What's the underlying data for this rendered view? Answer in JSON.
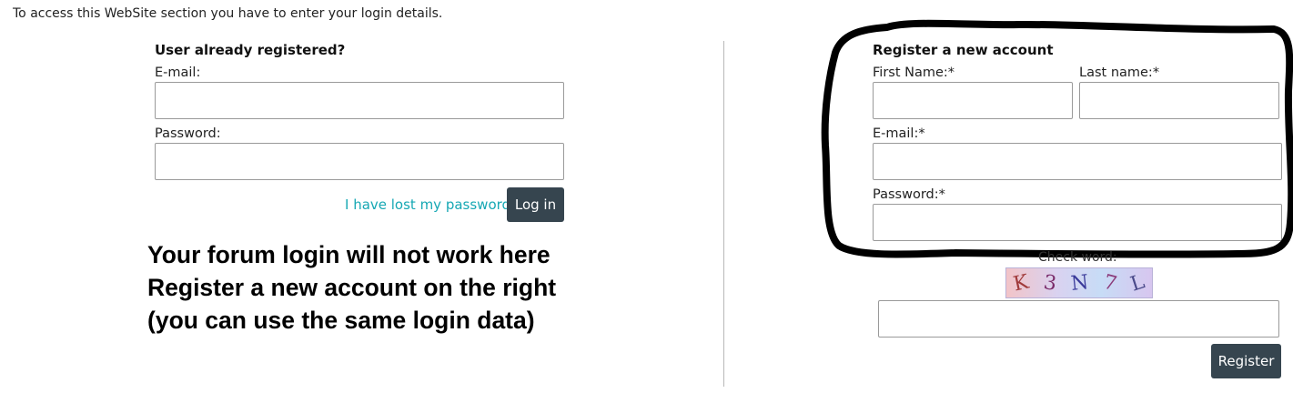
{
  "intro_text": "To access this WebSite section you have to enter your login details.",
  "login": {
    "heading": "User already registered?",
    "email_label": "E-mail:",
    "email_value": "",
    "password_label": "Password:",
    "password_value": "",
    "lost_password_link": "I have lost my password",
    "login_button": "Log in"
  },
  "note_lines": [
    "Your forum login will not work here",
    "Register a new account on the right",
    "(you can use the same login data)"
  ],
  "register": {
    "heading": "Register a new account",
    "first_name_label": "First Name:*",
    "first_name_value": "",
    "last_name_label": "Last name:*",
    "last_name_value": "",
    "email_label": "E-mail:*",
    "email_value": "",
    "password_label": "Password:*",
    "password_value": "",
    "check_word_label": "Check word:",
    "captcha_chars": [
      "K",
      "3",
      "N",
      "7",
      "L"
    ],
    "check_word_value": "",
    "register_button": "Register"
  },
  "colors": {
    "button_bg": "#36454f",
    "link": "#17a8b4",
    "highlight_stroke": "#000000"
  }
}
